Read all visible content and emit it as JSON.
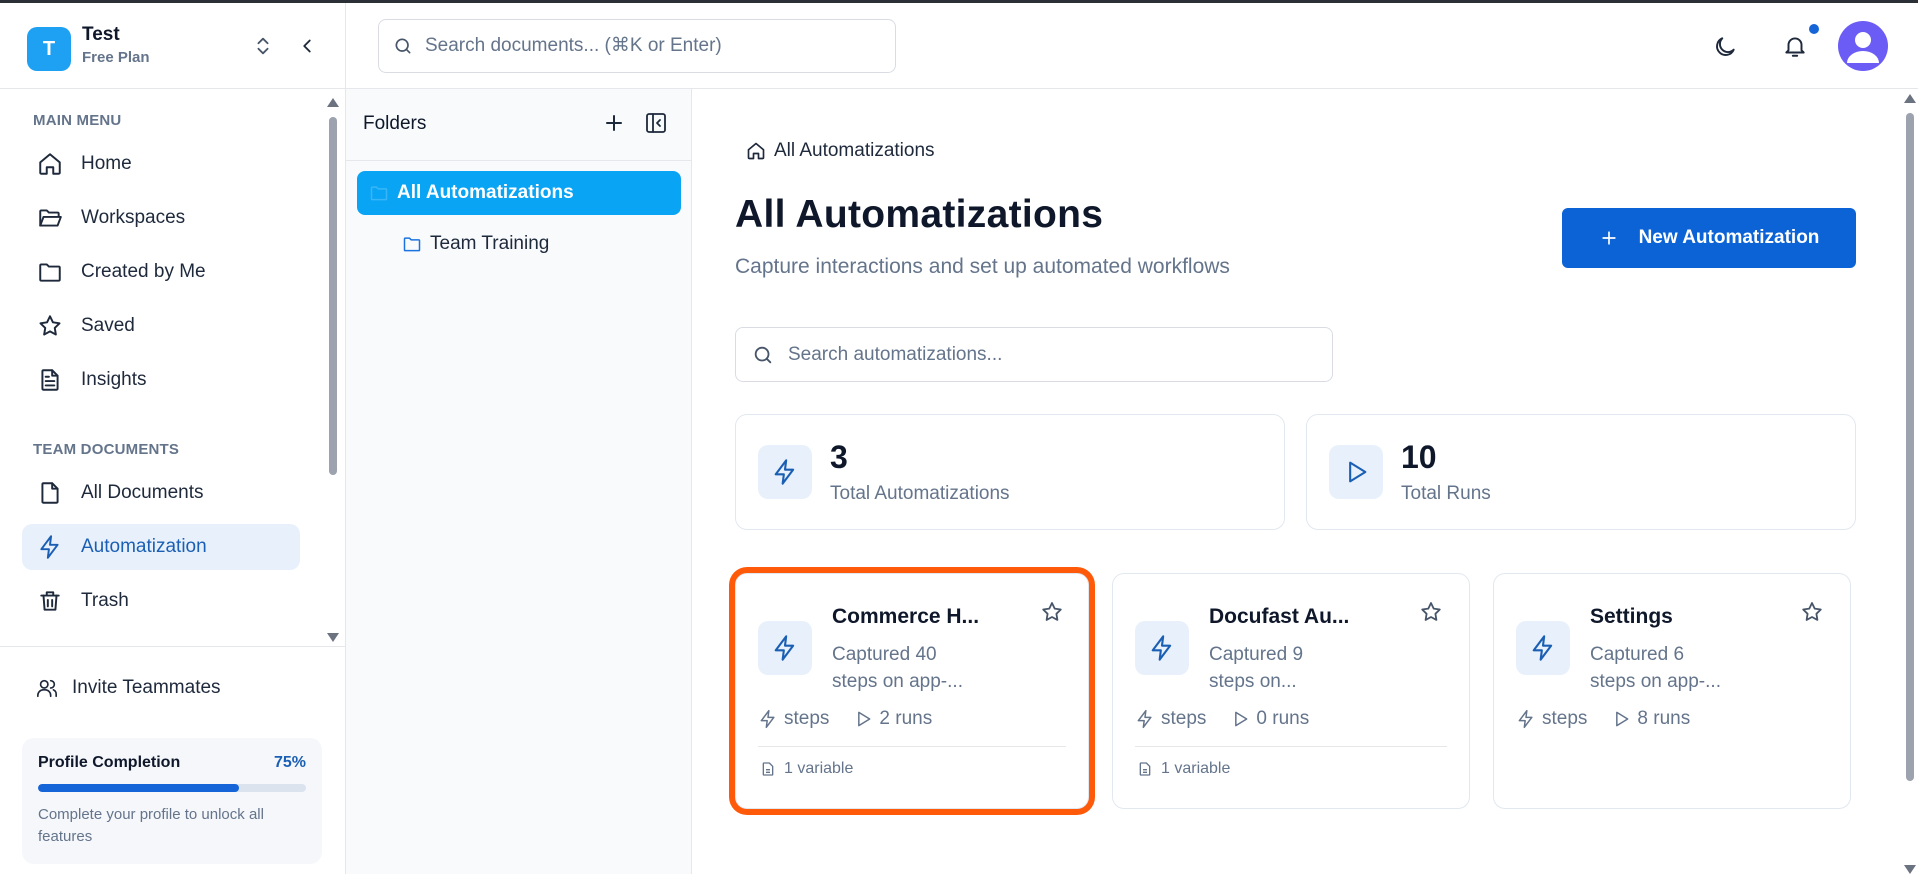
{
  "workspace": {
    "initial": "T",
    "name": "Test",
    "plan": "Free Plan"
  },
  "sidebar": {
    "main_menu_label": "MAIN MENU",
    "main_items": [
      {
        "label": "Home",
        "icon": "home-icon"
      },
      {
        "label": "Workspaces",
        "icon": "folder-open-icon"
      },
      {
        "label": "Created by Me",
        "icon": "folder-icon"
      },
      {
        "label": "Saved",
        "icon": "star-icon"
      },
      {
        "label": "Insights",
        "icon": "document-icon"
      }
    ],
    "team_label": "TEAM DOCUMENTS",
    "team_items": [
      {
        "label": "All Documents",
        "icon": "file-icon"
      },
      {
        "label": "Automatization",
        "icon": "lightning-icon",
        "active": true
      },
      {
        "label": "Trash",
        "icon": "trash-icon"
      }
    ],
    "invite_label": "Invite Teammates",
    "profile": {
      "title": "Profile Completion",
      "percent_label": "75%",
      "progress": 0.75,
      "description": "Complete your profile to unlock all features"
    }
  },
  "header": {
    "search_placeholder": "Search documents... (⌘K or Enter)",
    "accent_color": "#1565d8"
  },
  "folders": {
    "title": "Folders",
    "items": [
      {
        "label": "All Automatizations",
        "active": true
      },
      {
        "label": "Team Training",
        "active": false
      }
    ]
  },
  "main": {
    "breadcrumb": "All Automatizations",
    "title": "All Automatizations",
    "subtitle": "Capture interactions and set up automated workflows",
    "new_button": "New Automatization",
    "search_placeholder": "Search automatizations...",
    "stats": [
      {
        "value": "3",
        "label": "Total Automatizations",
        "icon": "lightning-icon"
      },
      {
        "value": "10",
        "label": "Total Runs",
        "icon": "play-icon"
      }
    ],
    "cards": [
      {
        "title": "Commerce H...",
        "desc_line1": "Captured 40",
        "desc_line2": "steps on app-...",
        "steps_label": "steps",
        "runs_label": "2 runs",
        "variable_label": "1 variable",
        "highlighted": true
      },
      {
        "title": "Docufast Au...",
        "desc_line1": "Captured 9",
        "desc_line2": "steps on...",
        "steps_label": "steps",
        "runs_label": "0 runs",
        "variable_label": "1 variable",
        "highlighted": false
      },
      {
        "title": "Settings",
        "desc_line1": "Captured 6",
        "desc_line2": "steps on app-...",
        "steps_label": "steps",
        "runs_label": "8 runs",
        "variable_label": "",
        "highlighted": false
      }
    ],
    "highlight_color": "#ff5a0a"
  }
}
